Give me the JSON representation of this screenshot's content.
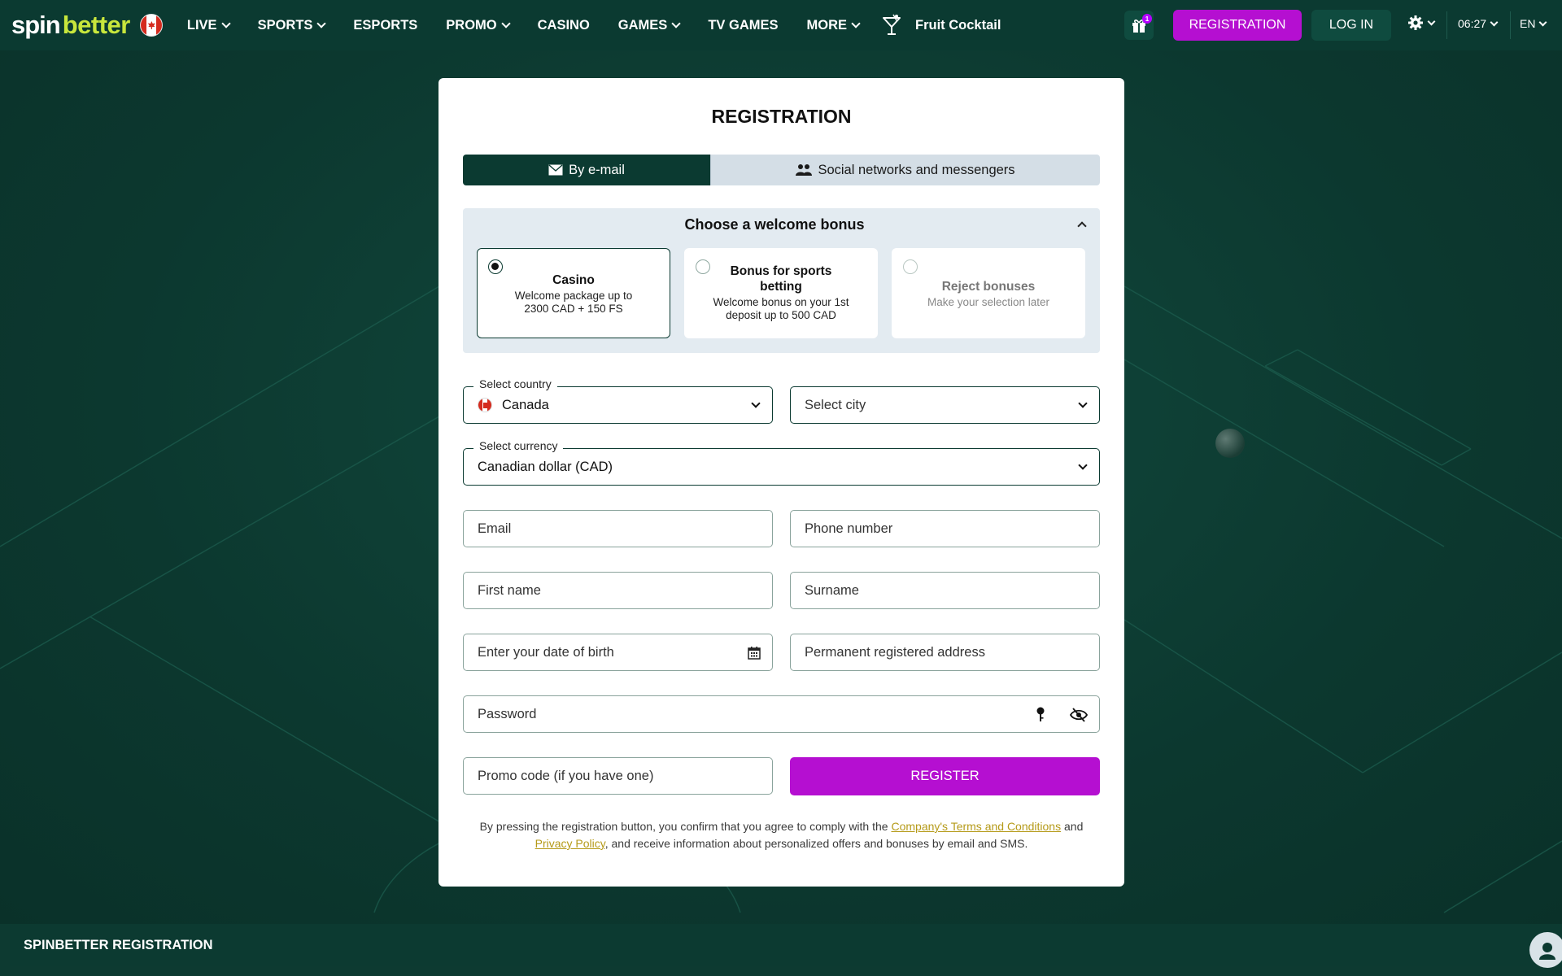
{
  "header": {
    "logo": {
      "part1": "spin",
      "part2": "better"
    },
    "nav": [
      {
        "label": "LIVE",
        "dropdown": true
      },
      {
        "label": "SPORTS",
        "dropdown": true
      },
      {
        "label": "ESPORTS",
        "dropdown": false
      },
      {
        "label": "PROMO",
        "dropdown": true
      },
      {
        "label": "CASINO",
        "dropdown": false
      },
      {
        "label": "GAMES",
        "dropdown": true
      },
      {
        "label": "TV GAMES",
        "dropdown": false
      },
      {
        "label": "MORE",
        "dropdown": true
      }
    ],
    "featured_game": "Fruit Cocktail",
    "gift_badge": "1",
    "registration_label": "REGISTRATION",
    "login_label": "LOG IN",
    "time": "06:27",
    "language": "EN",
    "icons": [
      "canada-flag-icon",
      "cocktail-icon",
      "gift-icon",
      "gear-icon"
    ]
  },
  "form": {
    "title": "REGISTRATION",
    "tabs": [
      {
        "label": "By e-mail",
        "icon": "envelope-icon",
        "active": true
      },
      {
        "label": "Social networks and messengers",
        "icon": "users-icon",
        "active": false
      }
    ],
    "bonus": {
      "title": "Choose a welcome bonus",
      "options": [
        {
          "name": "Casino",
          "desc": "Welcome package up to 2300 CAD + 150 FS",
          "selected": true
        },
        {
          "name": "Bonus for sports betting",
          "desc": "Welcome bonus on your 1st deposit up to 500 CAD",
          "selected": false
        },
        {
          "name": "Reject bonuses",
          "desc": "Make your selection later",
          "selected": false
        }
      ]
    },
    "country": {
      "label": "Select country",
      "value": "Canada"
    },
    "city": {
      "placeholder": "Select city"
    },
    "currency": {
      "label": "Select currency",
      "value": "Canadian dollar (CAD)"
    },
    "email": {
      "placeholder": "Email"
    },
    "phone": {
      "placeholder": "Phone number"
    },
    "first_name": {
      "placeholder": "First name"
    },
    "surname": {
      "placeholder": "Surname"
    },
    "dob": {
      "placeholder": "Enter your date of birth"
    },
    "address": {
      "placeholder": "Permanent registered address"
    },
    "password": {
      "placeholder": "Password"
    },
    "promo": {
      "placeholder": "Promo code (if you have one)"
    },
    "register_label": "REGISTER",
    "terms": {
      "pre": "By pressing the registration button, you confirm that you agree to comply with the ",
      "link1": "Company's Terms and Conditions",
      "mid": " and ",
      "link2": "Privacy Policy",
      "post": ", and receive information about personalized offers and bonuses by email and SMS."
    }
  },
  "footer": {
    "title": "SPINBETTER REGISTRATION"
  },
  "colors": {
    "primary": "#0b3a31",
    "accent": "#b50fd1",
    "logo_green": "#c8e63c",
    "link": "#b59a18"
  }
}
